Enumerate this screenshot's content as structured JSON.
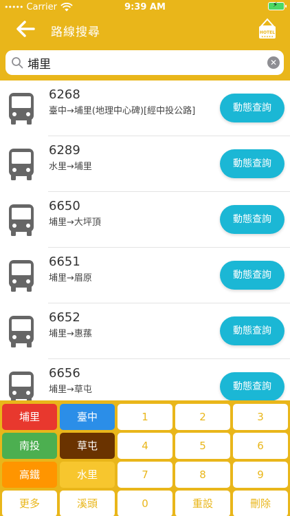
{
  "status_bar": {
    "dots": "•••••",
    "carrier": "Carrier",
    "time": "9:39 AM"
  },
  "nav": {
    "title": "路線搜尋",
    "hotel_badge": "HOTEL"
  },
  "search": {
    "value": "埔里"
  },
  "routes": [
    {
      "number": "6268",
      "description": "臺中→埔里(地理中心碑)[經中投公路]",
      "button": "動態查詢"
    },
    {
      "number": "6289",
      "description": "水里→埔里",
      "button": "動態查詢"
    },
    {
      "number": "6650",
      "description": "埔里→大坪頂",
      "button": "動態查詢"
    },
    {
      "number": "6651",
      "description": "埔里→眉原",
      "button": "動態查詢"
    },
    {
      "number": "6652",
      "description": "埔里→惠蓀",
      "button": "動態查詢"
    },
    {
      "number": "6656",
      "description": "埔里→草屯",
      "button": "動態查詢"
    }
  ],
  "keypad": {
    "row1": [
      "埔里",
      "臺中",
      "1",
      "2",
      "3"
    ],
    "row2": [
      "南投",
      "草屯",
      "4",
      "5",
      "6"
    ],
    "row3": [
      "高鐵",
      "水里",
      "7",
      "8",
      "9"
    ],
    "row4": [
      "更多",
      "溪頭",
      "0",
      "重設",
      "刪除"
    ]
  },
  "colors": {
    "brand": "#E9B61A",
    "action": "#1BB7D5"
  }
}
